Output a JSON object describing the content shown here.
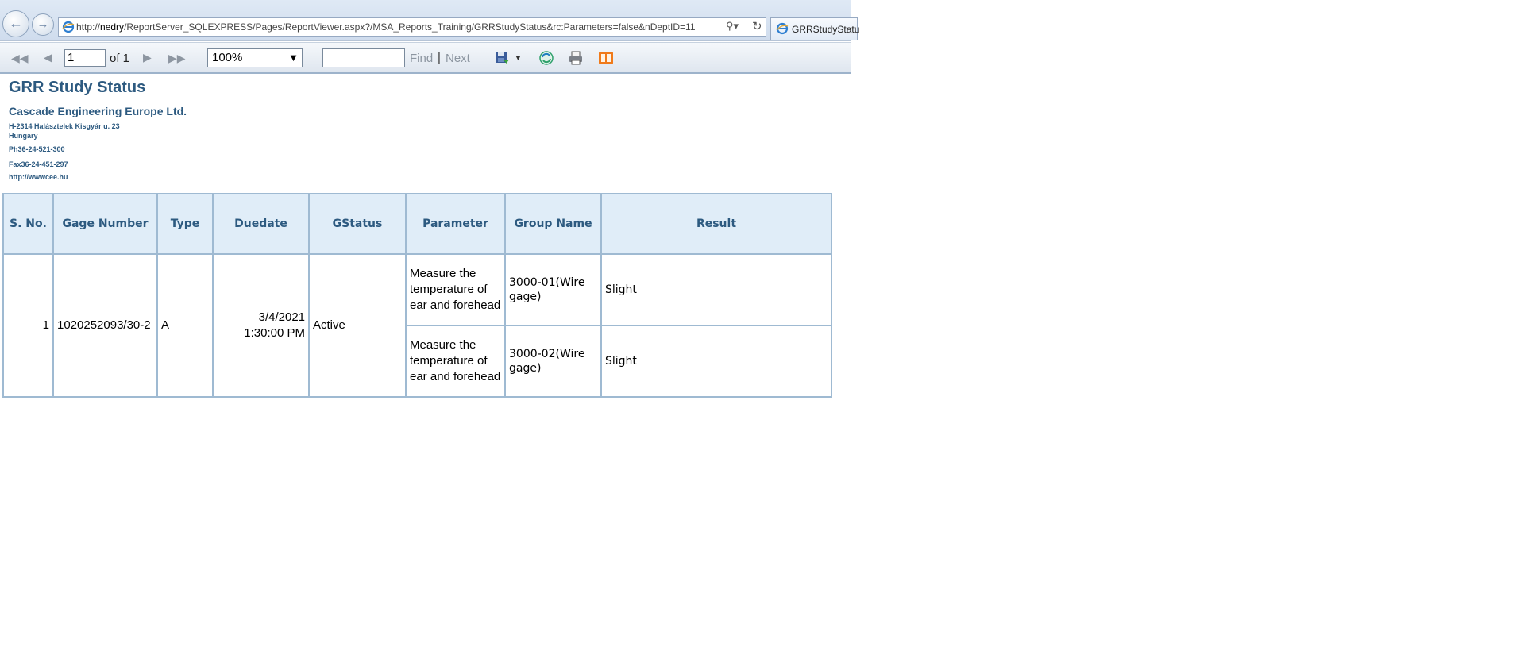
{
  "browser": {
    "address_prefix": "http://",
    "address_host": "nedry",
    "address_path": "/ReportServer_SQLEXPRESS/Pages/ReportViewer.aspx?/MSA_Reports_Training/GRRStudyStatus&rc:Parameters=false&nDeptID=11",
    "tab_title": "GRRStudyStatu",
    "back_icon": "arrow-left-icon",
    "forward_icon": "arrow-right-icon"
  },
  "toolbar": {
    "page_value": "1",
    "page_of": "of 1",
    "zoom_value": "100%",
    "find_value": "",
    "find_label": "Find",
    "separator": "|",
    "next_label": "Next"
  },
  "report": {
    "title": "GRR Study Status",
    "company": "Cascade Engineering Europe Ltd.",
    "address_line1": "H-2314 Halásztelek Kisgyár u. 23",
    "address_line2": "Hungary",
    "phone": "Ph36-24-521-300",
    "fax": "Fax36-24-451-297",
    "web": "http://wwwcee.hu"
  },
  "table": {
    "headers": [
      "S. No.",
      "Gage Number",
      "Type",
      "Duedate",
      "GStatus",
      "Parameter",
      "Group Name",
      "Result"
    ],
    "rows": [
      {
        "sno": "1",
        "gage_number": "1020252093/30-2",
        "type": "A",
        "duedate": "3/4/2021 1:30:00 PM",
        "gstatus": "Active",
        "details": [
          {
            "parameter": "Measure the temperature of ear and forehead",
            "group_name": "3000-01(Wire gage)",
            "result": "Slight"
          },
          {
            "parameter": "Measure the temperature of ear and forehead",
            "group_name": "3000-02(Wire gage)",
            "result": "Slight"
          }
        ]
      }
    ]
  },
  "colors": {
    "title_blue": "#2d5a80",
    "header_bg": "#e0edf8",
    "border": "#9fbad2"
  }
}
